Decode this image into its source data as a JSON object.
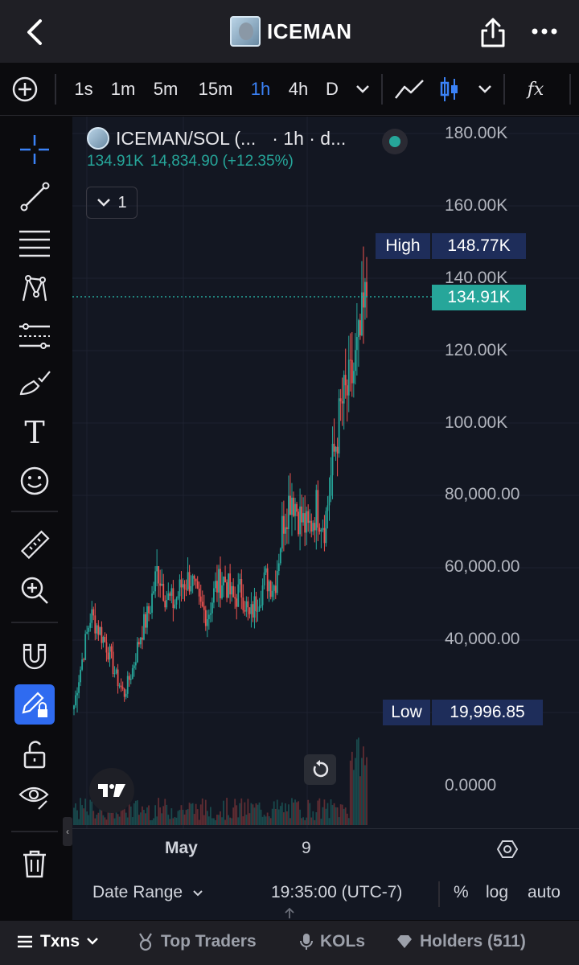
{
  "header": {
    "title": "ICEMAN",
    "back_icon": "chevron-left-icon",
    "share_icon": "share-icon",
    "more_icon": "more-dots-icon"
  },
  "toolbar": {
    "intervals": [
      "1s",
      "1m",
      "5m",
      "15m",
      "1h",
      "4h",
      "D"
    ],
    "active_interval": "1h",
    "add_icon": "plus-circle-icon",
    "indicator_label": "fx"
  },
  "rail": {
    "tools": [
      "crosshair-icon",
      "trend-line-icon",
      "fib-icon",
      "pattern-icon",
      "projection-icon",
      "brush-icon",
      "text-icon",
      "emoji-icon",
      "ruler-icon",
      "zoom-in-icon",
      "magnet-icon",
      "pencil-lock-icon",
      "lock-icon",
      "eye-icon",
      "trash-icon"
    ],
    "text_tool_label": "T"
  },
  "legend": {
    "symbol": "ICEMAN/SOL (...",
    "meta": "· 1h · d...",
    "price": "134.91K",
    "change": "14,834.90 (+12.35%)",
    "collapse_count": "1"
  },
  "price_axis": {
    "labels": [
      "180.00K",
      "160.00K",
      "140.00K",
      "120.00K",
      "100.00K",
      "80,000.00",
      "60,000.00",
      "40,000.00",
      "0.0000"
    ],
    "high_label": "High",
    "high_value": "148.77K",
    "current_value": "134.91K",
    "low_label": "Low",
    "low_value": "19,996.85"
  },
  "time_axis": {
    "labels": [
      "May",
      "9"
    ]
  },
  "bottom_bar": {
    "date_range": "Date Range",
    "time": "19:35:00 (UTC-7)",
    "percent": "%",
    "log": "log",
    "auto": "auto"
  },
  "tabs": {
    "txns": "Txns",
    "top_traders": "Top Traders",
    "kols": "KOLs",
    "holders": "Holders (511)"
  },
  "colors": {
    "up": "#26a69a",
    "down": "#ef5350",
    "accent": "#3b82f6",
    "tag_navy": "#1e2d5a"
  },
  "chart_data": {
    "type": "candlestick",
    "title": "ICEMAN/SOL",
    "interval": "1h",
    "ylim": [
      0,
      180000
    ],
    "high": 148770,
    "low": 19996.85,
    "last": 134910,
    "series": [
      {
        "name": "close",
        "values": [
          22000,
          35000,
          47000,
          43000,
          38000,
          30000,
          25000,
          32000,
          42000,
          48000,
          60000,
          52000,
          50000,
          56000,
          57000,
          49000,
          47000,
          55000,
          57000,
          51000,
          54000,
          46000,
          52000,
          57000,
          55000,
          73000,
          81000,
          74000,
          70000,
          77000,
          72000,
          90000,
          105000,
          110000,
          120000,
          134910
        ]
      }
    ]
  }
}
